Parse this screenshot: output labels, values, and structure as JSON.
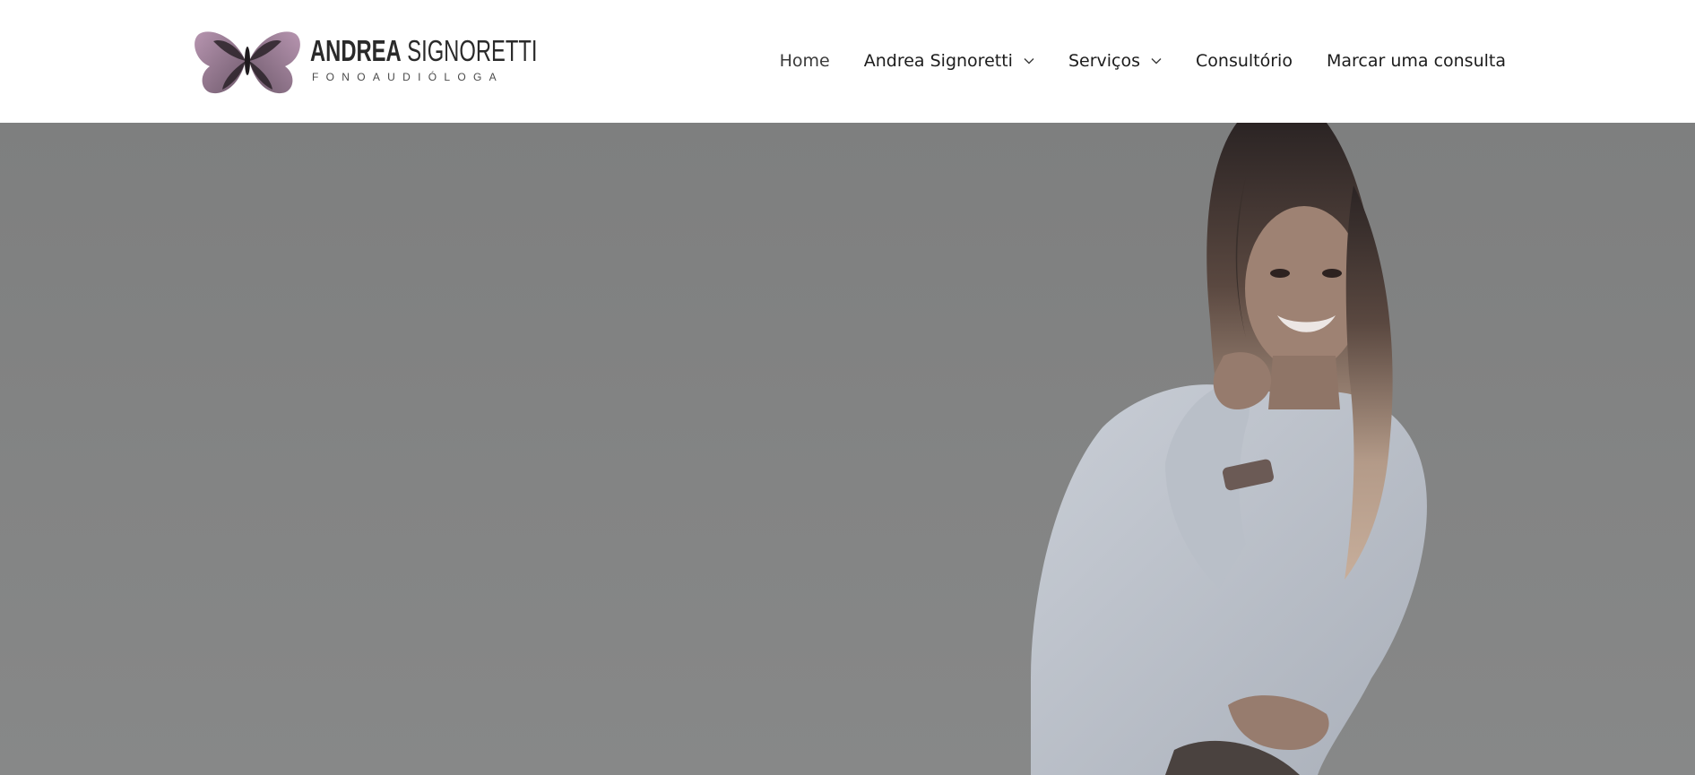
{
  "brand": {
    "name_part1": "ANDREA",
    "name_part2": "SIGNORETTI",
    "subtitle": "FONOAUDIÓLOGA",
    "logo_icon": "butterfly-icon"
  },
  "nav": {
    "items": [
      {
        "label": "Home",
        "has_dropdown": false,
        "active": true
      },
      {
        "label": "Andrea Signoretti",
        "has_dropdown": true,
        "active": false
      },
      {
        "label": "Serviços",
        "has_dropdown": true,
        "active": false
      },
      {
        "label": "Consultório",
        "has_dropdown": false,
        "active": false
      },
      {
        "label": "Marcar uma consulta",
        "has_dropdown": false,
        "active": false
      }
    ]
  },
  "hero": {
    "image": "portrait-photo",
    "overlay_color": "#838484"
  },
  "colors": {
    "accent": "#9a7a94",
    "text": "#1c1c1c",
    "header_bg": "#ffffff"
  }
}
